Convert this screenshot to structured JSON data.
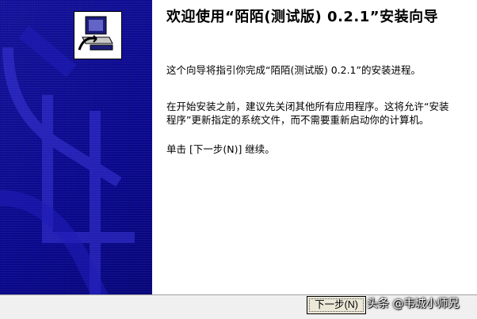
{
  "wizard": {
    "title": "欢迎使用“陌陌(测试版) 0.2.1”安装向导",
    "paragraphs": [
      "这个向导将指引你完成“陌陌(测试版) 0.2.1”的安装进程。",
      "在开始安装之前，建议先关闭其他所有应用程序。这将允许“安装程序”更新指定的系统文件，而不需要重新启动你的计算机。",
      "单击 [下一步(N)] 继续。"
    ],
    "next_label": "下一步(N)",
    "sidebar_color": "#0c0a9a"
  },
  "watermark": {
    "text": "头条 @韦城小师兄"
  }
}
